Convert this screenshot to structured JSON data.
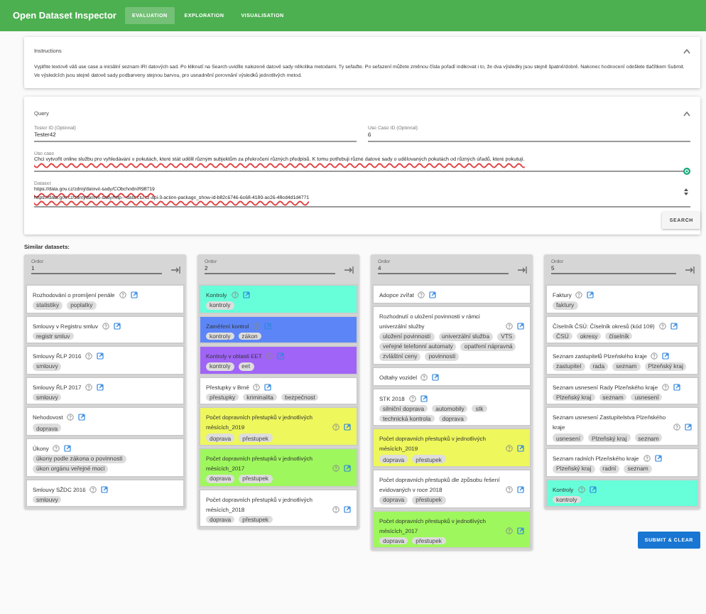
{
  "app": {
    "title": "Open Dataset Inspector"
  },
  "tabs": [
    {
      "label": "EVALUATION",
      "selected": true
    },
    {
      "label": "EXPLORATION",
      "selected": false
    },
    {
      "label": "VISUALISATION",
      "selected": false
    }
  ],
  "instructions": {
    "heading": "Instructions",
    "expanded": true,
    "text": "Vyplňte textově váš use case a iniciální seznam IRI datových sad. Po kliknutí na Search uvidíte nalezené datové sady několika metodami. Ty seřaďte. Po seřazení můžete změnou čísla pořadí indikovat i to, že dva výsledky jsou stejně špatné/dobré. Nakonec hodnocení odešlete tlačítkem Submit. Ve výsledcích jsou stejné datové sady podbarveny stejnou barvou, pro usnadnění porovnání výsledků jednotlivých metod."
  },
  "query": {
    "heading": "Query",
    "expanded": true,
    "tester_id": {
      "label": "Tester ID (Optional)",
      "value": "Tester42"
    },
    "use_case_id": {
      "label": "Use Case ID (Optional)",
      "value": "6"
    },
    "use_case": {
      "label": "Use case",
      "value": "Chci vytvořit online službu pro vyhledávání v pokutách, které stát udělil různým subjektům za překročení různých předpisů. K tomu potřebuji různé datové sady o udělovaných pokutách od různých úřadů, které pokutují."
    },
    "dataset": {
      "label": "Dataset",
      "lines": [
        "https://data.gov.cz/zdroj/datové-sady/CObchodníR98719",
        "https://data.gov.cz/zdroj/datové-sady/http---data.ctu.cz-api-3-action-package_show-id-b82c6746-6e68-4180-ae26-48ed4d1d4771"
      ]
    },
    "search_button": "SEARCH"
  },
  "similar_heading": "Similar datasets:",
  "columns": [
    {
      "order_label": "Order",
      "order": "1",
      "cards": [
        {
          "title": "Rozhodování o promíjení penále",
          "color": "#ffffff",
          "tags": [
            "statistiky",
            "poplatky"
          ]
        },
        {
          "title": "Smlouvy v Registru smluv",
          "color": "#ffffff",
          "tags": [
            "registr smluv"
          ]
        },
        {
          "title": "Smlouvy ŘLP 2016",
          "color": "#ffffff",
          "tags": [
            "smlouvy"
          ]
        },
        {
          "title": "Smlouvy ŘLP 2017",
          "color": "#ffffff",
          "tags": [
            "smlouvy"
          ]
        },
        {
          "title": "Nehodovost",
          "color": "#ffffff",
          "tags": [
            "doprava"
          ]
        },
        {
          "title": "Úkony",
          "color": "#ffffff",
          "tags": [
            "úkony podle zákona o povinnosti",
            "úkon orgánu veřejné moci"
          ]
        },
        {
          "title": "Smlouvy SŽDC 2016",
          "color": "#ffffff",
          "tags": [
            "smlouvy"
          ]
        }
      ]
    },
    {
      "order_label": "Order",
      "order": "2",
      "cards": [
        {
          "title": "Kontroly",
          "color": "#66ffd9",
          "tags": [
            "kontroly"
          ]
        },
        {
          "title": "Zaměření kontrol",
          "color": "#5c86f7",
          "tags": [
            "kontroly",
            "zákon"
          ]
        },
        {
          "title": "Kontroly v oblasti EET",
          "color": "#a064f7",
          "tags": [
            "kontroly",
            "eet"
          ]
        },
        {
          "title": "Přestupky v Brně",
          "color": "#ffffff",
          "tags": [
            "přestupky",
            "kriminalita",
            "bezpečnost"
          ]
        },
        {
          "title": "Počet dopravních přestupků v jednotlivých měsících_2019",
          "color": "#eef75c",
          "tags": [
            "doprava",
            "přestupek"
          ]
        },
        {
          "title": "Počet dopravních přestupků v jednotlivých měsících_2017",
          "color": "#9ef75c",
          "tags": [
            "doprava",
            "přestupek"
          ]
        },
        {
          "title": "Počet dopravních přestupků v jednotlivých měsících_2018",
          "color": "#ffffff",
          "tags": [
            "doprava",
            "přestupek"
          ]
        }
      ]
    },
    {
      "order_label": "Order",
      "order": "4",
      "cards": [
        {
          "title": "Adopce zvířat",
          "color": "#ffffff"
        },
        {
          "title": "Rozhodnutí o uložení povinnosti v rámci univerzální služby",
          "color": "#ffffff",
          "tags": [
            "uložení povinnosti",
            "univerzální služba",
            "VTS",
            "veřejné telefonní automaty",
            "opatření nápravná",
            "zvláštní ceny",
            "povinnosti"
          ]
        },
        {
          "title": "Odtahy vozidel",
          "color": "#ffffff"
        },
        {
          "title": "STK 2018",
          "color": "#ffffff",
          "tags": [
            "silniční doprava",
            "automobily",
            "stk",
            "technická kontrola",
            "doprava"
          ]
        },
        {
          "title": "Počet dopravních přestupků v jednotlivých měsících_2019",
          "color": "#eef75c",
          "tags": [
            "doprava",
            "přestupek"
          ]
        },
        {
          "title": "Počet dopravních přestupků dle způsobu řešení evidovaných v roce 2018",
          "color": "#ffffff",
          "tags": [
            "doprava",
            "přestupek"
          ]
        },
        {
          "title": "Počet dopravních přestupků v jednotlivých měsících_2017",
          "color": "#9ef75c",
          "tags": [
            "doprava",
            "přestupek"
          ]
        }
      ]
    },
    {
      "order_label": "Order",
      "order": "5",
      "cards": [
        {
          "title": "Faktury",
          "color": "#ffffff",
          "tags": [
            "faktury"
          ]
        },
        {
          "title": "Číselník ČSÚ: Číselník okresů (kód 109)",
          "color": "#ffffff",
          "tags": [
            "ČSÚ",
            "okresy",
            "číselník"
          ]
        },
        {
          "title": "Seznam zastupitelů Plzeňského kraje",
          "color": "#ffffff",
          "tags": [
            "zastupitel",
            "rada",
            "seznam",
            "Plzeňský kraj"
          ]
        },
        {
          "title": "Seznam usnesení Rady Plzeňského kraje",
          "color": "#ffffff",
          "tags": [
            "Plzeňský kraj",
            "seznam",
            "usnesení"
          ]
        },
        {
          "title": "Seznam usnesení Zastupitelstva Plzeňského kraje",
          "color": "#ffffff",
          "tags": [
            "usnesení",
            "Plzeňský kraj",
            "seznam"
          ]
        },
        {
          "title": "Seznam radních Plzeňského kraje",
          "color": "#ffffff",
          "tags": [
            "Plzeňský kraj",
            "radní",
            "seznam"
          ]
        },
        {
          "title": "Kontroly",
          "color": "#66ffd9",
          "tags": [
            "kontroly"
          ]
        }
      ]
    }
  ],
  "submit_button": "SUBMIT & CLEAR"
}
